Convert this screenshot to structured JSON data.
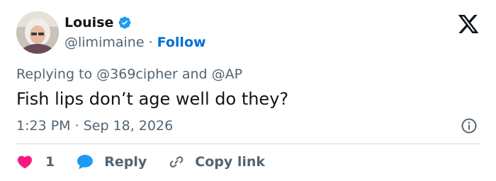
{
  "author": {
    "name": "Louise",
    "handle": "@limimaine",
    "separator": "·",
    "follow_label": "Follow",
    "verified_icon": "verified-badge-icon",
    "verified_color": "#1d9bf0"
  },
  "brand_icon": "x-logo-icon",
  "reply_context": {
    "prefix": "Replying to",
    "mention_1": "@369cipher",
    "conjunction": "and",
    "mention_2": "@AP"
  },
  "tweet": {
    "text": "Fish lips don’t age well do they?",
    "time": "1:23 PM",
    "separator": "·",
    "date": "Sep 18, 2026"
  },
  "actions": {
    "like_count": "1",
    "like_color": "#f91880",
    "reply_label": "Reply",
    "reply_color": "#1d9bf0",
    "copy_label": "Copy link"
  },
  "colors": {
    "text_primary": "#0f1419",
    "text_secondary": "#536471",
    "link": "#006fd6",
    "divider": "#cfd9de"
  }
}
